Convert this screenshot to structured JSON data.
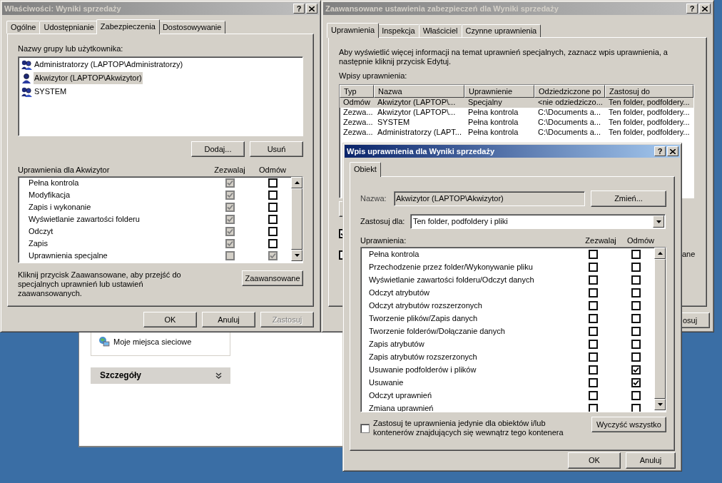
{
  "explorer_window": {
    "places": [
      {
        "label": "Moje miejsca sieciowe"
      }
    ],
    "details_panel": {
      "title": "Szczegóły"
    }
  },
  "properties_dialog": {
    "title": "Właściwości: Wyniki sprzedaży",
    "active": false,
    "help_button": "?",
    "tabs": [
      {
        "label": "Ogólne",
        "selected": false
      },
      {
        "label": "Udostępnianie",
        "selected": false
      },
      {
        "label": "Zabezpieczenia",
        "selected": true
      },
      {
        "label": "Dostosowywanie",
        "selected": false
      }
    ],
    "users_label": "Nazwy grupy lub użytkownika:",
    "users": [
      {
        "name": "Administratorzy (LAPTOP\\Administratorzy)",
        "kind": "group",
        "selected": false
      },
      {
        "name": "Akwizytor (LAPTOP\\Akwizytor)",
        "kind": "user",
        "selected": true
      },
      {
        "name": "SYSTEM",
        "kind": "group",
        "selected": false
      }
    ],
    "user_buttons": [
      "Dodaj...",
      "Usuń"
    ],
    "permissions_label": "Uprawnienia dla Akwizytor",
    "columns": [
      "Zezwalaj",
      "Odmów"
    ],
    "permissions": [
      {
        "name": "Pełna kontrola",
        "allow": {
          "checked": true,
          "disabled": true
        },
        "deny": {
          "checked": false,
          "disabled": false
        }
      },
      {
        "name": "Modyfikacja",
        "allow": {
          "checked": true,
          "disabled": true
        },
        "deny": {
          "checked": false,
          "disabled": false
        }
      },
      {
        "name": "Zapis i wykonanie",
        "allow": {
          "checked": true,
          "disabled": true
        },
        "deny": {
          "checked": false,
          "disabled": false
        }
      },
      {
        "name": "Wyświetlanie zawartości folderu",
        "allow": {
          "checked": true,
          "disabled": true
        },
        "deny": {
          "checked": false,
          "disabled": false
        }
      },
      {
        "name": "Odczyt",
        "allow": {
          "checked": true,
          "disabled": true
        },
        "deny": {
          "checked": false,
          "disabled": false
        }
      },
      {
        "name": "Zapis",
        "allow": {
          "checked": true,
          "disabled": true
        },
        "deny": {
          "checked": false,
          "disabled": false
        }
      },
      {
        "name": "Uprawnienia specjalne",
        "allow": {
          "checked": false,
          "disabled": true
        },
        "deny": {
          "checked": true,
          "disabled": true
        }
      }
    ],
    "hint": "Kliknij przycisk Zaawansowane, aby przejść do specjalnych uprawnień lub ustawień zaawansowanych.",
    "advanced_button": "Zaawansowane",
    "footer_buttons": [
      {
        "label": "OK",
        "disabled": false
      },
      {
        "label": "Anuluj",
        "disabled": false
      },
      {
        "label": "Zastosuj",
        "disabled": true
      }
    ]
  },
  "advanced_window": {
    "title": "Zaawansowane ustawienia zabezpieczeń dla Wyniki sprzedaży",
    "active": false,
    "help_button": "?",
    "tabs": [
      {
        "label": "Uprawnienia",
        "selected": true
      },
      {
        "label": "Inspekcja",
        "selected": false
      },
      {
        "label": "Właściciel",
        "selected": false
      },
      {
        "label": "Czynne uprawnienia",
        "selected": false
      }
    ],
    "description": "Aby wyświetlić więcej informacji na temat uprawnień specjalnych, zaznacz wpis uprawnienia, a następnie kliknij przycisk Edytuj.",
    "entries_label": "Wpisy uprawnienia:",
    "columns": [
      "Typ",
      "Nazwa",
      "Uprawnienie",
      "Odziedziczone po",
      "Zastosuj do"
    ],
    "rows": [
      {
        "cells": [
          "Odmów",
          "Akwizytor (LAPTOP\\...",
          "Specjalny",
          "<nie odziedziczo...",
          "Ten folder, podfoldery..."
        ],
        "selected": true
      },
      {
        "cells": [
          "Zezwa...",
          "Akwizytor (LAPTOP\\...",
          "Pełna kontrola",
          "C:\\Documents a...",
          "Ten folder, podfoldery..."
        ],
        "selected": false
      },
      {
        "cells": [
          "Zezwa...",
          "SYSTEM",
          "Pełna kontrola",
          "C:\\Documents a...",
          "Ten folder, podfoldery..."
        ],
        "selected": false
      },
      {
        "cells": [
          "Zezwa...",
          "Administratorzy (LAPT...",
          "Pełna kontrola",
          "C:\\Documents a...",
          "Ten folder, podfoldery..."
        ],
        "selected": false
      }
    ],
    "covered_checkboxes": [
      {
        "checked": true
      },
      {
        "checked": false
      }
    ],
    "covered_label": "ane",
    "covered_button": "osuj"
  },
  "entry_dialog": {
    "title": "Wpis uprawnienia dla Wyniki sprzedaży",
    "active": true,
    "help_button": "?",
    "tabs": [
      {
        "label": "Obiekt",
        "selected": true
      }
    ],
    "name_label": "Nazwa:",
    "name_value": "Akwizytor (LAPTOP\\Akwizytor)",
    "change_button": "Zmień...",
    "apply_label": "Zastosuj dla:",
    "apply_value": "Ten folder, podfoldery i pliki",
    "permissions_label": "Uprawnienia:",
    "columns": [
      "Zezwalaj",
      "Odmów"
    ],
    "permissions": [
      {
        "name": "Pełna kontrola",
        "allow": {
          "checked": false
        },
        "deny": {
          "checked": false
        }
      },
      {
        "name": "Przechodzenie przez folder/Wykonywanie pliku",
        "allow": {
          "checked": false
        },
        "deny": {
          "checked": false
        }
      },
      {
        "name": "Wyświetlanie zawartości folderu/Odczyt danych",
        "allow": {
          "checked": false
        },
        "deny": {
          "checked": false
        }
      },
      {
        "name": "Odczyt atrybutów",
        "allow": {
          "checked": false
        },
        "deny": {
          "checked": false
        }
      },
      {
        "name": "Odczyt atrybutów rozszerzonych",
        "allow": {
          "checked": false
        },
        "deny": {
          "checked": false
        }
      },
      {
        "name": "Tworzenie plików/Zapis danych",
        "allow": {
          "checked": false
        },
        "deny": {
          "checked": false
        }
      },
      {
        "name": "Tworzenie folderów/Dołączanie danych",
        "allow": {
          "checked": false
        },
        "deny": {
          "checked": false
        }
      },
      {
        "name": "Zapis atrybutów",
        "allow": {
          "checked": false
        },
        "deny": {
          "checked": false
        }
      },
      {
        "name": "Zapis atrybutów rozszerzonych",
        "allow": {
          "checked": false
        },
        "deny": {
          "checked": false
        }
      },
      {
        "name": "Usuwanie podfolderów i plików",
        "allow": {
          "checked": false
        },
        "deny": {
          "checked": true
        }
      },
      {
        "name": "Usuwanie",
        "allow": {
          "checked": false
        },
        "deny": {
          "checked": true
        }
      },
      {
        "name": "Odczyt uprawnień",
        "allow": {
          "checked": false
        },
        "deny": {
          "checked": false
        }
      },
      {
        "name": "Zmiana uprawnień",
        "allow": {
          "checked": false
        },
        "deny": {
          "checked": false
        }
      }
    ],
    "inherit_checkbox": {
      "label": "Zastosuj te uprawnienia jedynie dla obiektów i/lub kontenerów znajdujących się wewnątrz tego kontenera",
      "checked": false
    },
    "clear_button": "Wyczyść wszystko",
    "footer_buttons": [
      {
        "label": "OK",
        "disabled": false
      },
      {
        "label": "Anuluj",
        "disabled": false
      }
    ]
  }
}
